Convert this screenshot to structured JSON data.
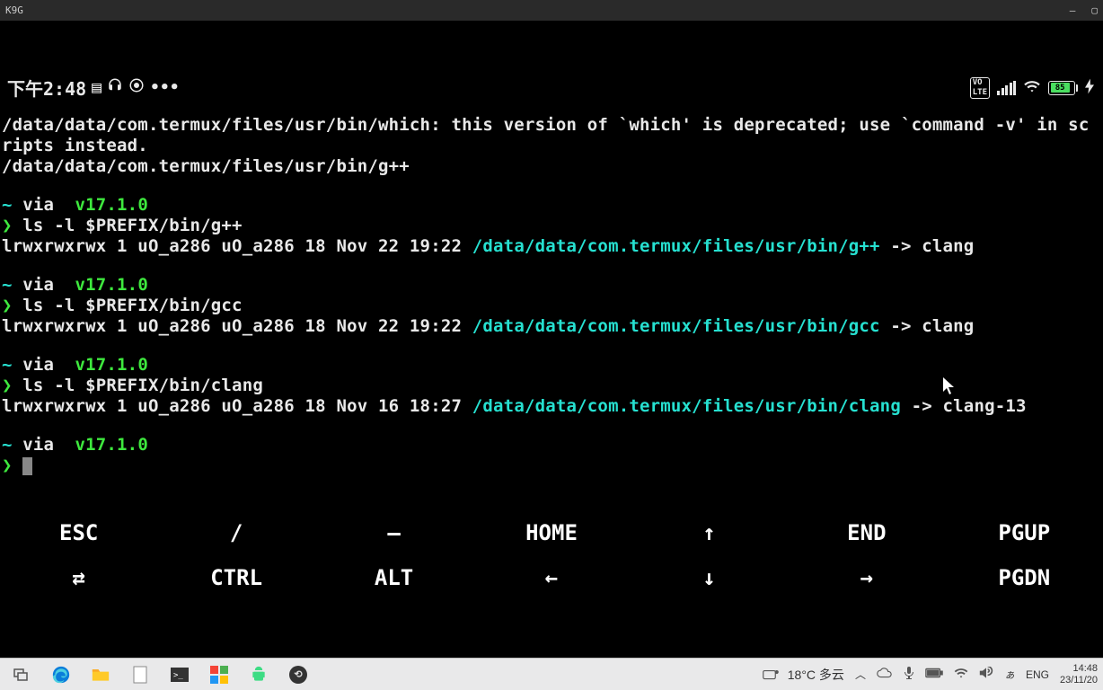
{
  "titlebar": {
    "app": "K9G",
    "min": "—",
    "max": "▢"
  },
  "phone_status": {
    "time": "下午2:48",
    "dots": "•••",
    "volte": "VO\nLTE",
    "battery_pct": "85"
  },
  "terminal": {
    "warn_l1": "/data/data/com.termux/files/usr/bin/which: this version of `which' is deprecated; use `command -v' in scripts instead.",
    "warn_l2": "/data/data/com.termux/files/usr/bin/g++",
    "prompt_head_tilde": "~",
    "prompt_head_via": " via  ",
    "node_ver": "v17.1.0",
    "arrow": "❯",
    "cmd1": " ls -l $PREFIX/bin/g++",
    "out1_pre": "lrwxrwxrwx 1 uO_a286 uO_a286 18 Nov 22 19:22 ",
    "out1_path": "/data/data/com.termux/files/usr/bin/g++",
    "out1_post": " -> clang",
    "cmd2": " ls -l $PREFIX/bin/gcc",
    "out2_pre": "lrwxrwxrwx 1 uO_a286 uO_a286 18 Nov 22 19:22 ",
    "out2_path": "/data/data/com.termux/files/usr/bin/gcc",
    "out2_post": " -> clang",
    "cmd3": " ls -l $PREFIX/bin/clang",
    "out3_pre": "lrwxrwxrwx 1 uO_a286 uO_a286 18 Nov 16 18:27 ",
    "out3_path": "/data/data/com.termux/files/usr/bin/clang",
    "out3_post": " -> clang-13"
  },
  "keys": {
    "esc": "ESC",
    "slash": "/",
    "dash": "—",
    "home": "HOME",
    "up": "↑",
    "end": "END",
    "pgup": "PGUP",
    "tab": "⇄",
    "ctrl": "CTRL",
    "alt": "ALT",
    "left": "←",
    "down": "↓",
    "right": "→",
    "pgdn": "PGDN"
  },
  "taskbar": {
    "weather": "18°C 多云",
    "lang": "ENG",
    "time": "14:48",
    "date": "23/11/20"
  }
}
